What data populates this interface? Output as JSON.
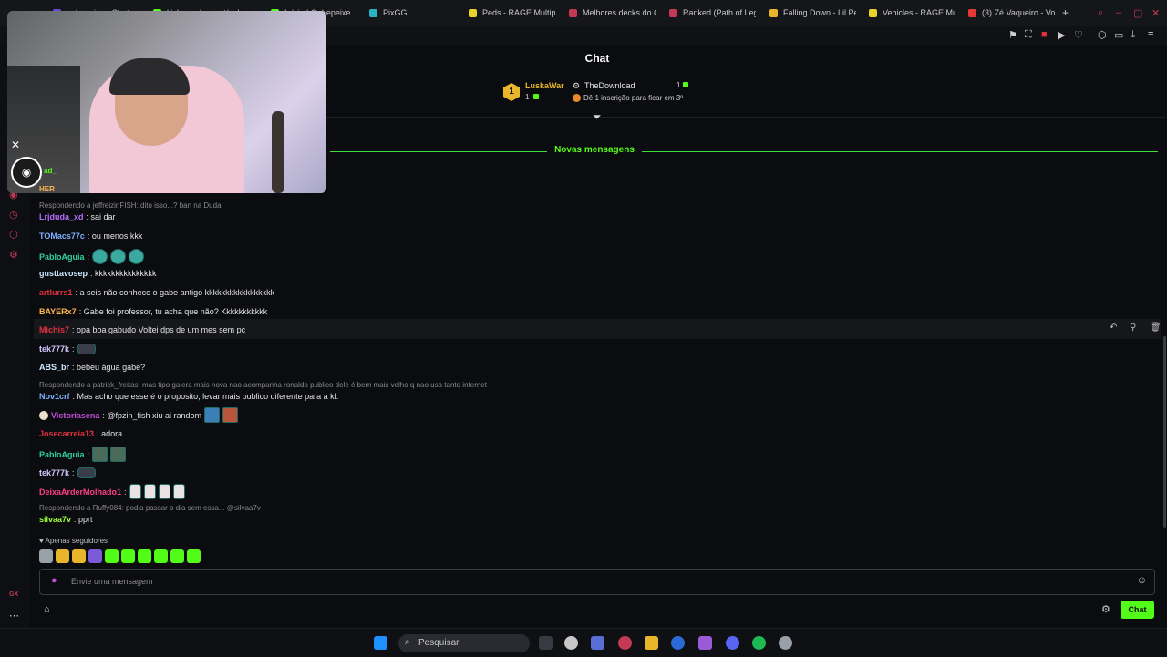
{
  "browser": {
    "tabs": [
      {
        "label": "gabepeixe - Chat",
        "color": "#6b4bd6"
      },
      {
        "label": "kick.com/popout/gabep",
        "color": "#53fc18"
      },
      {
        "label": "Início | Gabepeixe",
        "color": "#53fc18"
      },
      {
        "label": "PixGG",
        "color": "#27b3c2"
      },
      {
        "label": "Peds - RAGE Multipl",
        "color": "#e6d42a"
      },
      {
        "label": "Melhores decks do C",
        "color": "#c43a55"
      },
      {
        "label": "Ranked (Path of Leg",
        "color": "#c43a55"
      },
      {
        "label": "Falling Down - Lil Pe",
        "color": "#e9b52a"
      },
      {
        "label": "Vehicles - RAGE Mu",
        "color": "#e6d42a"
      },
      {
        "label": "(3) Zé Vaqueiro - Vo",
        "color": "#e53935"
      }
    ],
    "new_tab": "+"
  },
  "chat": {
    "title": "Chat",
    "leaderboard": {
      "rank": "1",
      "user1": "LuskaWar",
      "user1_count": "1",
      "user2": "TheDownload",
      "user2_count": "1",
      "hint": "Dê 1 inscrição para ficar em 3º"
    },
    "new_messages_label": "Novas mensagens",
    "partial_user": "ad_",
    "partial_user2": "HER",
    "messages": [
      {
        "type": "reply",
        "text": "Respondendo a jeffreizinFISH: dito isso...? ban na Duda"
      },
      {
        "user": "Lrjduda_xd",
        "color": "#b56cff",
        "text": ": sai dar"
      },
      {
        "user": "TOMacs77c",
        "color": "#7fb0ff",
        "text": ": ou menos kkk"
      },
      {
        "user": "PabloAguia",
        "color": "#2fd19d",
        "text": ":"
      },
      {
        "user": "gusttavosep",
        "color": "#cfe8ff",
        "text": ": kkkkkkkkkkkkkkk"
      },
      {
        "user": "artlurrs1",
        "color": "#e0313f",
        "text": ": a seis não conhece o gabe antigo kkkkkkkkkkkkkkkkk"
      },
      {
        "user": "BAYERx7",
        "color": "#ffb84d",
        "text": ": Gabe foi professor, tu acha que não? Kkkkkkkkkkk"
      },
      {
        "user": "Michis7",
        "color": "#e0313f",
        "text": ": opa boa gabudo Voltei dps de um mes sem pc"
      },
      {
        "user": "tek777k",
        "color": "#d6c7ff",
        "text": ":"
      },
      {
        "user": "ABS_br",
        "color": "#cfe8ff",
        "text": ": bebeu água gabe?"
      },
      {
        "type": "reply",
        "text": "Respondendo a patrick_freitas: mas tipo galera mais nova nao acompanha ronaldo publico dele é bem mais velho q nao usa tanto internet"
      },
      {
        "user": "Nov1crf",
        "color": "#7fb0ff",
        "text": ": Mas acho que esse é o proposito, levar mais publico diferente para a kl."
      },
      {
        "user": "Victoriasena",
        "color": "#c44bd6",
        "text": ": @fpzin_fish xiu ai random"
      },
      {
        "user": "Josecarreia13",
        "color": "#e0313f",
        "text": ": adora"
      },
      {
        "user": "PabloAguia",
        "color": "#2fd19d",
        "text": ":"
      },
      {
        "user": "tek777k",
        "color": "#d6c7ff",
        "text": ":"
      },
      {
        "user": "DeixaArderMolhado1",
        "color": "#ff3d8b",
        "text": ":"
      },
      {
        "type": "reply",
        "text": "Respondendo a Ruffy084: podia passar o dia sem essa... @silvaa7v"
      },
      {
        "user": "silvaa7v",
        "color": "#9dff3a",
        "text": ": pprt"
      }
    ],
    "followers_only": "Apenas seguidores",
    "input_placeholder": "Envie uma mensagem",
    "send_button": "Chat"
  },
  "taskbar": {
    "search_placeholder": "Pesquisar"
  },
  "sidebar": {
    "gx_label": "GX"
  }
}
